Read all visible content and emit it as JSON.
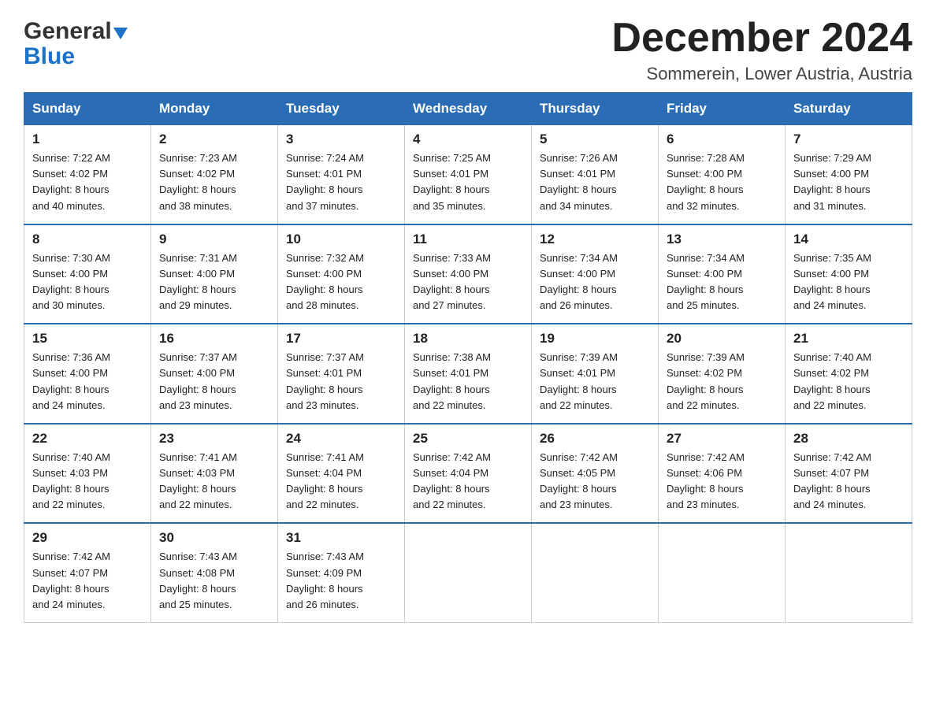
{
  "logo": {
    "general": "General",
    "blue": "Blue",
    "triangle": "▶"
  },
  "title": {
    "month_year": "December 2024",
    "location": "Sommerein, Lower Austria, Austria"
  },
  "days_of_week": [
    "Sunday",
    "Monday",
    "Tuesday",
    "Wednesday",
    "Thursday",
    "Friday",
    "Saturday"
  ],
  "weeks": [
    [
      {
        "day": "1",
        "sunrise": "7:22 AM",
        "sunset": "4:02 PM",
        "daylight": "8 hours and 40 minutes."
      },
      {
        "day": "2",
        "sunrise": "7:23 AM",
        "sunset": "4:02 PM",
        "daylight": "8 hours and 38 minutes."
      },
      {
        "day": "3",
        "sunrise": "7:24 AM",
        "sunset": "4:01 PM",
        "daylight": "8 hours and 37 minutes."
      },
      {
        "day": "4",
        "sunrise": "7:25 AM",
        "sunset": "4:01 PM",
        "daylight": "8 hours and 35 minutes."
      },
      {
        "day": "5",
        "sunrise": "7:26 AM",
        "sunset": "4:01 PM",
        "daylight": "8 hours and 34 minutes."
      },
      {
        "day": "6",
        "sunrise": "7:28 AM",
        "sunset": "4:00 PM",
        "daylight": "8 hours and 32 minutes."
      },
      {
        "day": "7",
        "sunrise": "7:29 AM",
        "sunset": "4:00 PM",
        "daylight": "8 hours and 31 minutes."
      }
    ],
    [
      {
        "day": "8",
        "sunrise": "7:30 AM",
        "sunset": "4:00 PM",
        "daylight": "8 hours and 30 minutes."
      },
      {
        "day": "9",
        "sunrise": "7:31 AM",
        "sunset": "4:00 PM",
        "daylight": "8 hours and 29 minutes."
      },
      {
        "day": "10",
        "sunrise": "7:32 AM",
        "sunset": "4:00 PM",
        "daylight": "8 hours and 28 minutes."
      },
      {
        "day": "11",
        "sunrise": "7:33 AM",
        "sunset": "4:00 PM",
        "daylight": "8 hours and 27 minutes."
      },
      {
        "day": "12",
        "sunrise": "7:34 AM",
        "sunset": "4:00 PM",
        "daylight": "8 hours and 26 minutes."
      },
      {
        "day": "13",
        "sunrise": "7:34 AM",
        "sunset": "4:00 PM",
        "daylight": "8 hours and 25 minutes."
      },
      {
        "day": "14",
        "sunrise": "7:35 AM",
        "sunset": "4:00 PM",
        "daylight": "8 hours and 24 minutes."
      }
    ],
    [
      {
        "day": "15",
        "sunrise": "7:36 AM",
        "sunset": "4:00 PM",
        "daylight": "8 hours and 24 minutes."
      },
      {
        "day": "16",
        "sunrise": "7:37 AM",
        "sunset": "4:00 PM",
        "daylight": "8 hours and 23 minutes."
      },
      {
        "day": "17",
        "sunrise": "7:37 AM",
        "sunset": "4:01 PM",
        "daylight": "8 hours and 23 minutes."
      },
      {
        "day": "18",
        "sunrise": "7:38 AM",
        "sunset": "4:01 PM",
        "daylight": "8 hours and 22 minutes."
      },
      {
        "day": "19",
        "sunrise": "7:39 AM",
        "sunset": "4:01 PM",
        "daylight": "8 hours and 22 minutes."
      },
      {
        "day": "20",
        "sunrise": "7:39 AM",
        "sunset": "4:02 PM",
        "daylight": "8 hours and 22 minutes."
      },
      {
        "day": "21",
        "sunrise": "7:40 AM",
        "sunset": "4:02 PM",
        "daylight": "8 hours and 22 minutes."
      }
    ],
    [
      {
        "day": "22",
        "sunrise": "7:40 AM",
        "sunset": "4:03 PM",
        "daylight": "8 hours and 22 minutes."
      },
      {
        "day": "23",
        "sunrise": "7:41 AM",
        "sunset": "4:03 PM",
        "daylight": "8 hours and 22 minutes."
      },
      {
        "day": "24",
        "sunrise": "7:41 AM",
        "sunset": "4:04 PM",
        "daylight": "8 hours and 22 minutes."
      },
      {
        "day": "25",
        "sunrise": "7:42 AM",
        "sunset": "4:04 PM",
        "daylight": "8 hours and 22 minutes."
      },
      {
        "day": "26",
        "sunrise": "7:42 AM",
        "sunset": "4:05 PM",
        "daylight": "8 hours and 23 minutes."
      },
      {
        "day": "27",
        "sunrise": "7:42 AM",
        "sunset": "4:06 PM",
        "daylight": "8 hours and 23 minutes."
      },
      {
        "day": "28",
        "sunrise": "7:42 AM",
        "sunset": "4:07 PM",
        "daylight": "8 hours and 24 minutes."
      }
    ],
    [
      {
        "day": "29",
        "sunrise": "7:42 AM",
        "sunset": "4:07 PM",
        "daylight": "8 hours and 24 minutes."
      },
      {
        "day": "30",
        "sunrise": "7:43 AM",
        "sunset": "4:08 PM",
        "daylight": "8 hours and 25 minutes."
      },
      {
        "day": "31",
        "sunrise": "7:43 AM",
        "sunset": "4:09 PM",
        "daylight": "8 hours and 26 minutes."
      },
      null,
      null,
      null,
      null
    ]
  ]
}
